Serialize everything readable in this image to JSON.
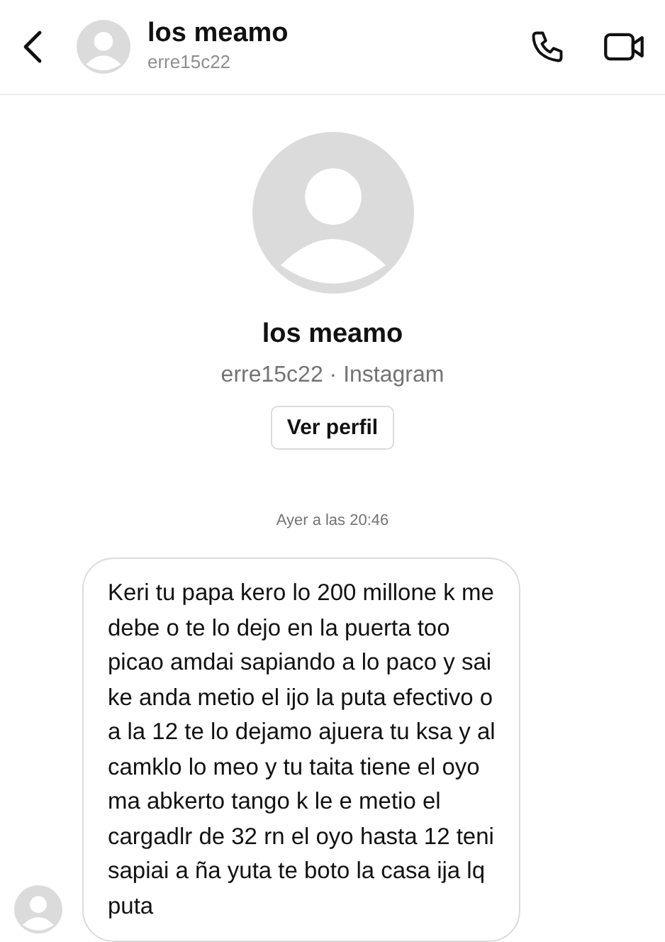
{
  "header": {
    "name": "los meamo",
    "username": "erre15c22"
  },
  "profile": {
    "name": "los meamo",
    "subtitle": "erre15c22 · Instagram",
    "button": "Ver perfil"
  },
  "timestamp": "Ayer a las 20:46",
  "messages": [
    {
      "kind": "received",
      "text": "Keri tu papa kero lo 200 millone k me\ndebe o te lo dejo en la puerta too\npicao amdai sapiando a lo paco y sai\nke anda metio el ijo la puta efectivo o\na la 12 te lo dejamo ajuera tu ksa y al\ncamklo lo meo y tu taita tiene el oyo\nma abkerto tango k le e metio el\ncargadlr de 32 rn el oyo hasta 12 teni\nsapiai a ña yuta te boto la casa ija lq\nputa"
    }
  ]
}
